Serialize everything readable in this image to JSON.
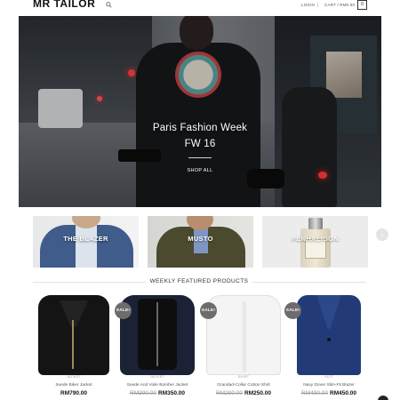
{
  "header": {
    "logo": "MR TAILOR",
    "login": "LOGIN",
    "cart": "CART / RM0.00",
    "cart_count": "0"
  },
  "hero": {
    "title_line1": "Paris Fashion Week",
    "title_line2": "FW 16",
    "button": "SHOP ALL"
  },
  "categories": [
    {
      "label": "THE BLAZER"
    },
    {
      "label": "MUSTO"
    },
    {
      "label": "PENHALIGON"
    }
  ],
  "featured": {
    "title": "WEEKLY FEATURED PRODUCTS",
    "sale_label": "SALE!",
    "products": [
      {
        "category": "JACKET",
        "name": "Suede Biker Jacket",
        "old_price": "",
        "price": "RM790.00",
        "on_sale": false
      },
      {
        "category": "JACKET",
        "name": "Suede And Voile Bomber Jacket",
        "old_price": "RM390.00",
        "price": "RM350.00",
        "on_sale": true
      },
      {
        "category": "SHIRT",
        "name": "Grandad-Collar Cotton Shirt",
        "old_price": "RM290.00",
        "price": "RM250.00",
        "on_sale": true
      },
      {
        "category": "SUIT",
        "name": "Navy Dover Slim-Fit Blazer",
        "old_price": "RM490.00",
        "price": "RM450.00",
        "on_sale": true
      }
    ]
  }
}
